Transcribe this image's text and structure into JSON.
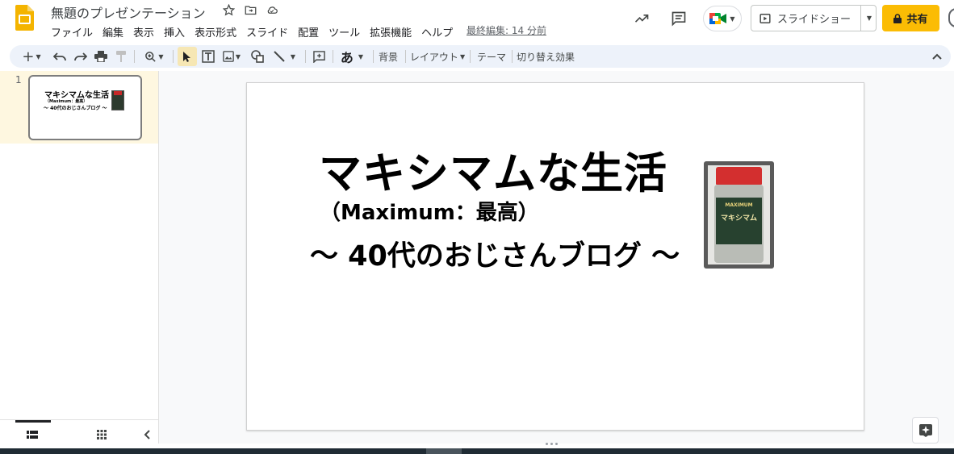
{
  "app": {
    "doc_title": "無題のプレゼンテーション",
    "last_edit": "最終編集: 14 分前",
    "slideshow_label": "スライドショー",
    "share_label": "共有",
    "colors": {
      "share": "#fbbc04",
      "logo": "#f4b400",
      "selected_tool": "#f6e7b4",
      "toolbar_bg": "#edf2fa"
    }
  },
  "menu": [
    "ファイル",
    "編集",
    "表示",
    "挿入",
    "表示形式",
    "スライド",
    "配置",
    "ツール",
    "拡張機能",
    "ヘルプ"
  ],
  "toolbar": {
    "text_style": "あ",
    "background": "背景",
    "layout": "レイアウト",
    "theme": "テーマ",
    "transition": "切り替え効果"
  },
  "filmstrip": {
    "slide_number": "1"
  },
  "slide": {
    "title": "マキシマムな生活",
    "subtitle": "（Maximum：最高）",
    "blog": "～ 40代のおじさんブログ ～",
    "bottle_label": "マキシマム",
    "bottle_brand": "MAXIMUM"
  }
}
